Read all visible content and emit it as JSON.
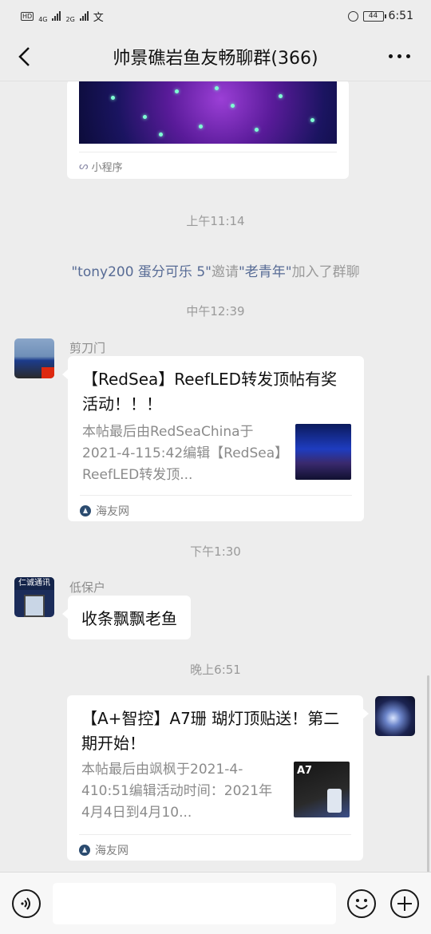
{
  "status_bar": {
    "network_left": "4G",
    "network_right": "2G",
    "battery": "44",
    "time": "6:51"
  },
  "nav": {
    "title": "帅景礁岩鱼友畅聊群(366)"
  },
  "messages": {
    "mini_program": {
      "label": "小程序"
    },
    "time_1": "上午11:14",
    "system_notice": {
      "inviter": "\"tony200 蛋分可乐 5\"",
      "action": "邀请",
      "invitee": "\"老青年\"",
      "tail": "加入了群聊"
    },
    "time_2": "中午12:39",
    "msg_1": {
      "sender": "剪刀门",
      "title": "【RedSea】ReefLED转发顶帖有奖活动！！！",
      "desc": "本帖最后由RedSeaChina于2021-4-115:42编辑【RedSea】ReefLED转发顶...",
      "source": "海友网"
    },
    "time_3": "下午1:30",
    "msg_2": {
      "sender": "低保户",
      "avatar_sign": "仁诚通讯",
      "text": "收条飘飘老鱼"
    },
    "time_4": "晚上6:51",
    "msg_3": {
      "title": "【A+智控】A7珊 瑚灯顶贴送！第二期开始！",
      "desc": "本帖最后由飒枫于2021-4-410:51编辑活动时间：2021年4月4日到4月10...",
      "thumb_label": "A7",
      "source": "海友网"
    }
  },
  "input_bar": {
    "voice_icon": "voice-icon",
    "emoji_icon": "emoji-icon",
    "plus_icon": "plus-icon"
  }
}
